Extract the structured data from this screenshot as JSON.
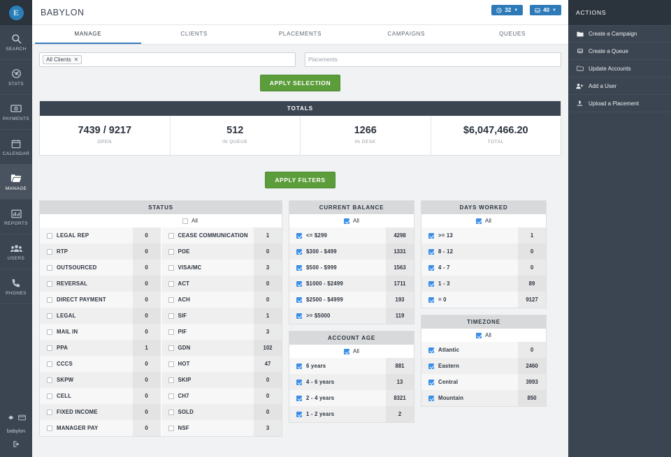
{
  "app": {
    "logo_letter": "E",
    "title": "BABYLON"
  },
  "header_badges": [
    {
      "icon": "clock-icon",
      "value": "32"
    },
    {
      "icon": "inbox-icon",
      "value": "40"
    }
  ],
  "sidebar": {
    "items": [
      {
        "label": "SEARCH",
        "icon": "search-icon",
        "active": false
      },
      {
        "label": "STATS",
        "icon": "gauge-icon",
        "active": false
      },
      {
        "label": "PAYMENTS",
        "icon": "money-icon",
        "active": false
      },
      {
        "label": "CALENDAR",
        "icon": "calendar-icon",
        "active": false
      },
      {
        "label": "MANAGE",
        "icon": "folder-icon",
        "active": true
      },
      {
        "label": "REPORTS",
        "icon": "bar-chart-icon",
        "active": false
      },
      {
        "label": "USERS",
        "icon": "users-icon",
        "active": false
      },
      {
        "label": "PHONES",
        "icon": "phone-icon",
        "active": false
      }
    ],
    "footer": {
      "username": "babylon",
      "settings_icon": "gear-icon",
      "card_icon": "card-icon",
      "logout_icon": "logout-icon"
    }
  },
  "tabs": [
    {
      "label": "MANAGE",
      "active": true
    },
    {
      "label": "CLIENTS",
      "active": false
    },
    {
      "label": "PLACEMENTS",
      "active": false
    },
    {
      "label": "CAMPAIGNS",
      "active": false
    },
    {
      "label": "QUEUES",
      "active": false
    }
  ],
  "selection": {
    "client_chip": "All Clients",
    "chip_remove_icon": "close-icon",
    "placements_placeholder": "Placements",
    "apply_selection_label": "APPLY SELECTION"
  },
  "totals": {
    "heading": "TOTALS",
    "cells": [
      {
        "value": "7439 / 9217",
        "label": "OPEN"
      },
      {
        "value": "512",
        "label": "IN QUEUE"
      },
      {
        "value": "1266",
        "label": "IN DESK"
      },
      {
        "value": "$6,047,466.20",
        "label": "TOTAL"
      }
    ]
  },
  "apply_filters_label": "APPLY FILTERS",
  "panels": {
    "status": {
      "title": "STATUS",
      "all_label": "All",
      "all_checked": false,
      "left_rows": [
        {
          "label": "LEGAL REP",
          "count": "0",
          "checked": false
        },
        {
          "label": "RTP",
          "count": "0",
          "checked": false
        },
        {
          "label": "OUTSOURCED",
          "count": "0",
          "checked": false
        },
        {
          "label": "REVERSAL",
          "count": "0",
          "checked": false
        },
        {
          "label": "DIRECT PAYMENT",
          "count": "0",
          "checked": false
        },
        {
          "label": "LEGAL",
          "count": "0",
          "checked": false
        },
        {
          "label": "MAIL IN",
          "count": "0",
          "checked": false
        },
        {
          "label": "PPA",
          "count": "1",
          "checked": false
        },
        {
          "label": "CCCS",
          "count": "0",
          "checked": false
        },
        {
          "label": "SKPW",
          "count": "0",
          "checked": false
        },
        {
          "label": "CELL",
          "count": "0",
          "checked": false
        },
        {
          "label": "FIXED INCOME",
          "count": "0",
          "checked": false
        },
        {
          "label": "MANAGER PAY",
          "count": "0",
          "checked": false
        }
      ],
      "right_rows": [
        {
          "label": "CEASE COMMUNICATION",
          "count": "1",
          "checked": false
        },
        {
          "label": "POE",
          "count": "0",
          "checked": false
        },
        {
          "label": "VISA/MC",
          "count": "3",
          "checked": false
        },
        {
          "label": "ACT",
          "count": "0",
          "checked": false
        },
        {
          "label": "ACH",
          "count": "0",
          "checked": false
        },
        {
          "label": "SIF",
          "count": "1",
          "checked": false
        },
        {
          "label": "PIF",
          "count": "3",
          "checked": false
        },
        {
          "label": "GDN",
          "count": "102",
          "checked": false
        },
        {
          "label": "HOT",
          "count": "47",
          "checked": false
        },
        {
          "label": "SKIP",
          "count": "0",
          "checked": false
        },
        {
          "label": "CH7",
          "count": "0",
          "checked": false
        },
        {
          "label": "SOLD",
          "count": "0",
          "checked": false
        },
        {
          "label": "NSF",
          "count": "3",
          "checked": false
        }
      ]
    },
    "current_balance": {
      "title": "CURRENT BALANCE",
      "all_label": "All",
      "all_checked": true,
      "rows": [
        {
          "label": "<= $299",
          "count": "4298",
          "checked": true
        },
        {
          "label": "$300 - $499",
          "count": "1331",
          "checked": true
        },
        {
          "label": "$500 - $999",
          "count": "1563",
          "checked": true
        },
        {
          "label": "$1000 - $2499",
          "count": "1711",
          "checked": true
        },
        {
          "label": "$2500 - $4999",
          "count": "193",
          "checked": true
        },
        {
          "label": ">= $5000",
          "count": "119",
          "checked": true
        }
      ]
    },
    "days_worked": {
      "title": "DAYS WORKED",
      "all_label": "All",
      "all_checked": true,
      "rows": [
        {
          "label": ">= 13",
          "count": "1",
          "checked": true
        },
        {
          "label": "8 - 12",
          "count": "0",
          "checked": true
        },
        {
          "label": "4 - 7",
          "count": "0",
          "checked": true
        },
        {
          "label": "1 - 3",
          "count": "89",
          "checked": true
        },
        {
          "label": "= 0",
          "count": "9127",
          "checked": true
        }
      ]
    },
    "account_age": {
      "title": "ACCOUNT AGE",
      "all_label": "All",
      "all_checked": true,
      "rows": [
        {
          "label": "6 years",
          "count": "881",
          "checked": true
        },
        {
          "label": "4 - 6 years",
          "count": "13",
          "checked": true
        },
        {
          "label": "2 - 4 years",
          "count": "8321",
          "checked": true
        },
        {
          "label": "1 - 2 years",
          "count": "2",
          "checked": true
        }
      ]
    },
    "timezone": {
      "title": "TIMEZONE",
      "all_label": "All",
      "all_checked": true,
      "rows": [
        {
          "label": "Atlantic",
          "count": "0",
          "checked": true
        },
        {
          "label": "Eastern",
          "count": "2460",
          "checked": true
        },
        {
          "label": "Central",
          "count": "3993",
          "checked": true
        },
        {
          "label": "Mountain",
          "count": "850",
          "checked": true
        }
      ]
    }
  },
  "actions": {
    "heading": "ACTIONS",
    "items": [
      {
        "label": "Create a Campaign",
        "icon": "folder-filled-icon"
      },
      {
        "label": "Create a Queue",
        "icon": "inbox-icon"
      },
      {
        "label": "Update Accounts",
        "icon": "folder-outline-icon"
      },
      {
        "label": "Add a User",
        "icon": "user-plus-icon"
      },
      {
        "label": "Upload a Placement",
        "icon": "upload-icon"
      }
    ]
  },
  "colors": {
    "sidebar_bg": "#3b4552",
    "dark_header": "#2b333d",
    "accent_blue": "#2e7ab8",
    "green_button": "#5c9d3b",
    "checkbox_blue": "#3b8fe8",
    "tab_active": "#3b7dbf"
  }
}
